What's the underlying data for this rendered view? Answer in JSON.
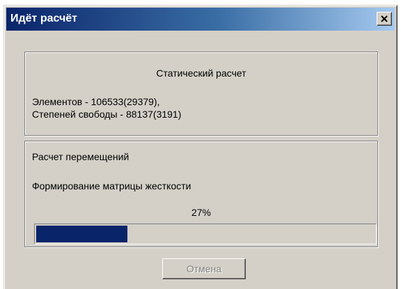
{
  "window": {
    "title": "Идёт расчёт"
  },
  "static_panel": {
    "title": "Статический расчет",
    "elements_text": "Элементов - 106533(29379),",
    "dof_text": "Степеней свободы - 88137(3191)"
  },
  "progress_panel": {
    "section_title": "Расчет перемещений",
    "operation_text": "Формирование матрицы жесткости",
    "percent_text": "27%",
    "progress_value": 0.27
  },
  "buttons": {
    "cancel_label": "Отмена",
    "cancel_enabled": false
  },
  "icons": {
    "close": "close-icon"
  },
  "colors": {
    "title_gradient_start": "#0a246a",
    "title_gradient_end": "#a6caf0",
    "progress_fill": "#0a246a",
    "dialog_background": "#d4d0c8"
  }
}
